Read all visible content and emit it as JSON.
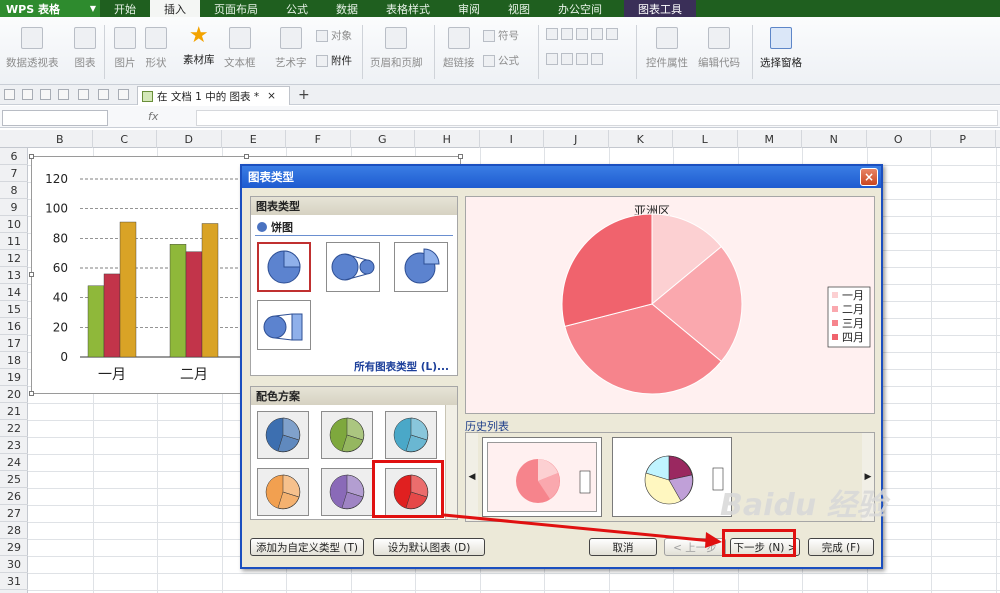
{
  "app": {
    "logo": "WPS 表格"
  },
  "menu": {
    "tabs": [
      "开始",
      "插入",
      "页面布局",
      "公式",
      "数据",
      "表格样式",
      "审阅",
      "视图",
      "办公空间"
    ],
    "active_tab": "插入",
    "tool_tab": "图表工具"
  },
  "ribbon": {
    "pivot": "数据透视表",
    "chart": "图表",
    "picture": "图片",
    "shape": "形状",
    "material": "素材库",
    "textbox": "文本框",
    "wordart": "艺术字",
    "object": "对象",
    "attachment": "附件",
    "header_footer": "页眉和页脚",
    "hyperlink": "超链接",
    "symbol": "符号",
    "formula": "公式",
    "control_props": "控件属性",
    "edit_code": "编辑代码",
    "select_pane": "选择窗格"
  },
  "doc_tab": {
    "label": "在 文档 1 中的 图表 *",
    "close": "×",
    "add": "+"
  },
  "formula_bar": {
    "fx": "fx"
  },
  "grid": {
    "columns": [
      "B",
      "C",
      "D",
      "E",
      "F",
      "G",
      "H",
      "I",
      "J",
      "K",
      "L",
      "M",
      "N",
      "O",
      "P"
    ],
    "rows": [
      "6",
      "7",
      "8",
      "9",
      "10",
      "11",
      "12",
      "13",
      "14",
      "15",
      "16",
      "17",
      "18",
      "19",
      "20",
      "21",
      "22",
      "23",
      "24",
      "25",
      "26",
      "27",
      "28",
      "29",
      "30",
      "31"
    ]
  },
  "chart_data": [
    {
      "type": "bar",
      "categories": [
        "一月",
        "二月"
      ],
      "series": [
        {
          "values": [
            48,
            76
          ]
        },
        {
          "values": [
            56,
            71
          ]
        },
        {
          "values": [
            91,
            90
          ]
        }
      ],
      "ylim": [
        0,
        120
      ],
      "yticks": [
        "0",
        "20",
        "40",
        "60",
        "80",
        "100",
        "120"
      ],
      "colors": [
        "#8fb83a",
        "#c2344a",
        "#d9a326"
      ],
      "grid": true
    },
    {
      "type": "pie",
      "title": "亚洲区",
      "categories": [
        "一月",
        "二月",
        "三月",
        "四月"
      ],
      "values": [
        14,
        22,
        35,
        29
      ],
      "colors": [
        "#fcd0d2",
        "#faa8ae",
        "#f6848c",
        "#f0636d"
      ],
      "legend": "right"
    }
  ],
  "dialog": {
    "title": "图表类型",
    "close": "×",
    "chart_types_header": "图表类型",
    "category": "饼图",
    "all_types_link": "所有图表类型 (L)...",
    "color_scheme_header": "配色方案",
    "history_label": "历史列表",
    "buttons": {
      "add_custom": "添加为自定义类型 (T)",
      "set_default": "设为默认图表 (D)",
      "cancel": "取消",
      "prev": "< 上一步",
      "next": "下一步 (N) >",
      "finish": "完成 (F)"
    },
    "scheme_colors": [
      "#3d6fb0",
      "#7ea83d",
      "#4aa8c8",
      "#f2a050",
      "#8a6ab8",
      "#e02020"
    ]
  },
  "watermark": "Baidu 经验"
}
